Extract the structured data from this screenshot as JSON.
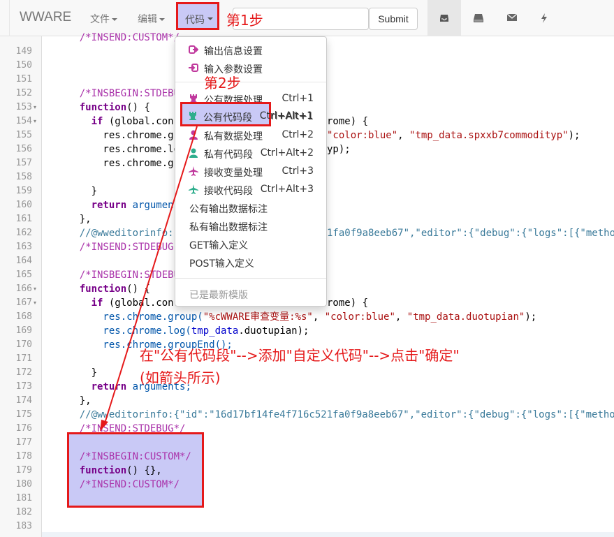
{
  "navbar": {
    "brand": "WWARE",
    "menus": [
      {
        "label": "文件"
      },
      {
        "label": "编辑"
      },
      {
        "label": "代码"
      }
    ],
    "search_placeholder": "",
    "submit_label": "Submit",
    "icons": [
      "inbox-icon",
      "hdd-icon",
      "envelope-icon",
      "flash-icon"
    ]
  },
  "annotations": {
    "step1": "第1步",
    "step2": "第2步",
    "instruction_line1": "在\"公有代码段\"-->添加\"自定义代码\"-->点击\"确定\"",
    "instruction_line2": "(如箭头所示)"
  },
  "dropdown": {
    "items": [
      {
        "label": "输出信息设置",
        "icon": "output-settings-icon",
        "icon_color": "#c0399d"
      },
      {
        "label": "输入参数设置",
        "icon": "input-settings-icon",
        "icon_color": "#c0399d"
      },
      {
        "label": "公有数据处理",
        "icon": "public-data-icon",
        "icon_color": "#c0399d",
        "shortcut": "Ctrl+1"
      },
      {
        "label": "公有代码段",
        "icon": "public-code-icon",
        "icon_color": "#2eae8d",
        "shortcut": "Ctrl+Alt+1"
      },
      {
        "label": "私有数据处理",
        "icon": "private-data-icon",
        "icon_color": "#c0399d",
        "shortcut": "Ctrl+2"
      },
      {
        "label": "私有代码段",
        "icon": "private-code-icon",
        "icon_color": "#2eae8d",
        "shortcut": "Ctrl+Alt+2"
      },
      {
        "label": "接收变量处理",
        "icon": "receive-var-icon",
        "icon_color": "#c0399d",
        "shortcut": "Ctrl+3"
      },
      {
        "label": "接收代码段",
        "icon": "receive-code-icon",
        "icon_color": "#2eae8d",
        "shortcut": "Ctrl+Alt+3"
      },
      {
        "label": "公有输出数据标注"
      },
      {
        "label": "私有输出数据标注"
      },
      {
        "label": "GET输入定义"
      },
      {
        "label": "POST输入定义"
      },
      {
        "label": "已是最新模版"
      }
    ]
  },
  "editor": {
    "line_numbers": [
      "149",
      "150",
      "151",
      "152",
      "153",
      "154",
      "155",
      "156",
      "157",
      "158",
      "159",
      "160",
      "161",
      "162",
      "163",
      "164",
      "165",
      "166",
      "167",
      "168",
      "169",
      "170",
      "171",
      "172",
      "173",
      "174",
      "175",
      "176",
      "177",
      "178",
      "179",
      "180",
      "181",
      "182",
      "183"
    ],
    "lines": {
      "l148": "    /*INSEND:CUSTOM*/",
      "l152": "    /*INSBEGIN:STDEBU",
      "l153a": "    ",
      "l153b": "function",
      "l153c": "() {",
      "l154a": "      ",
      "l154b": "if",
      "l154c": " (global.con",
      "l154d": "rome) {",
      "l155a": "        res.chrome.g",
      "l155b": "\"color:blue\"",
      "l155c": ", ",
      "l155d": "\"tmp_data.spxxb7commodityp\"",
      "l155e": ");",
      "l156a": "        res.chrome.lo",
      "l156b": "yp);",
      "l157": "        res.chrome.g",
      "l159": "      }",
      "l160a": "      ",
      "l160b": "return",
      "l160c": " argumen",
      "l161": "    },",
      "l162a": "    //@wweditorinfo:",
      "l162b": "1fa0f9a8eeb67\",\"editor\":{\"debug\":{\"logs\":[{\"metho",
      "l163": "    /*INSEND:STDEBUG",
      "l165": "    /*INSBEGIN:STDEBU",
      "l166a": "    ",
      "l166b": "function",
      "l166c": "() {",
      "l167a": "      ",
      "l167b": "if",
      "l167c": " (global.con",
      "l167d": "rome) {",
      "l168a": "        res.chrome.group(",
      "l168b": "\"%cWWARE审查变量:%s\"",
      "l168c": ", ",
      "l168d": "\"color:blue\"",
      "l168e": ", ",
      "l168f": "\"tmp_data.duotupian\"",
      "l168g": ");",
      "l169a": "        res.chrome.log(",
      "l169b": "tmp_data",
      "l169c": ".duotupian);",
      "l170": "        res.chrome.groupEnd();",
      "l172": "      }",
      "l173a": "      ",
      "l173b": "return",
      "l173c": " arguments;",
      "l174": "    },",
      "l175": "    //@wweditorinfo:{\"id\":\"16d17bf14fe4f716c521fa0f9a8eeb67\",\"editor\":{\"debug\":{\"logs\":[{\"metho",
      "l176": "    /*INSEND:STDEBUG*/",
      "l178": "    /*INSBEGIN:CUSTOM*/",
      "l179a": "    ",
      "l179b": "function",
      "l179c": "() {},",
      "l180": "    /*INSEND:CUSTOM*/"
    }
  },
  "colors": {
    "annotation_red": "#e5191a",
    "highlight_fill": "#c9c9f6"
  }
}
